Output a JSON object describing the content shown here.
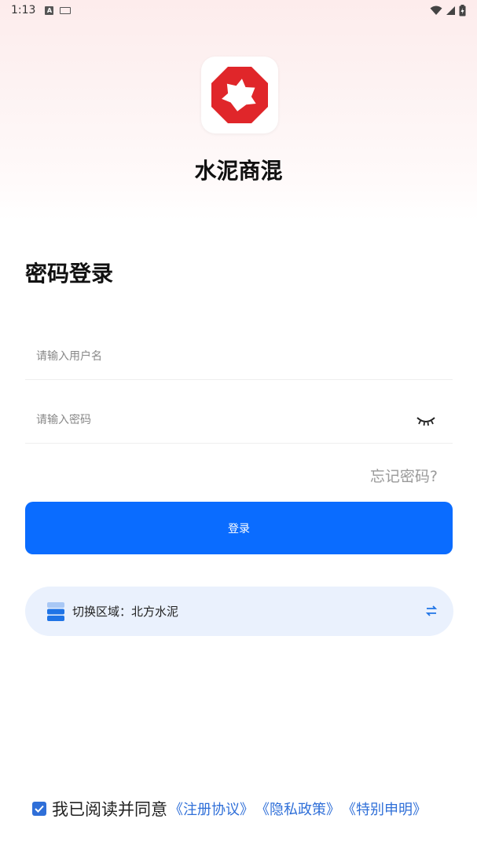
{
  "status_bar": {
    "time": "1:13",
    "icons": [
      "a-icon",
      "keyboard-icon",
      "wifi-icon",
      "signal-icon",
      "battery-icon"
    ]
  },
  "app": {
    "name": "水泥商混",
    "logo_color": "#e0262a"
  },
  "login": {
    "title": "密码登录",
    "username_placeholder": "请输入用户名",
    "password_placeholder": "请输入密码",
    "forgot_label": "忘记密码?",
    "button_label": "登录",
    "button_color": "#0a6cff"
  },
  "region": {
    "label": "切换区域：北方水泥",
    "icon": "server-icon",
    "switch_icon": "swap-icon"
  },
  "agreement": {
    "checked": true,
    "text": "我已阅读并同意",
    "links": [
      "《注册协议》",
      "《隐私政策》",
      "《特别申明》"
    ],
    "link_color": "#2f6fd8"
  }
}
